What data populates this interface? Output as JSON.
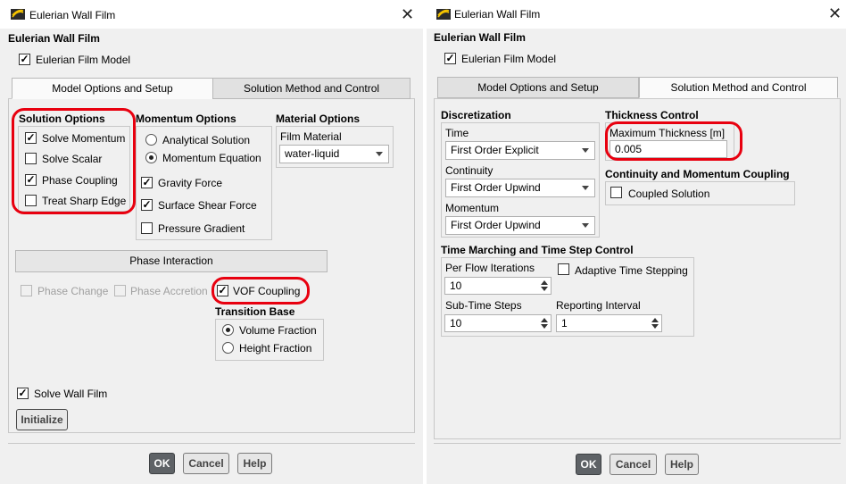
{
  "left": {
    "window_title": "Eulerian Wall Film",
    "header": "Eulerian Wall Film",
    "film_model": {
      "label": "Eulerian Film Model",
      "checked": true
    },
    "tabs": [
      {
        "label": "Model Options and Setup",
        "active": true
      },
      {
        "label": "Solution Method and Control",
        "active": false
      }
    ],
    "solution_options": {
      "title": "Solution Options",
      "items": [
        {
          "label": "Solve Momentum",
          "checked": true
        },
        {
          "label": "Solve Scalar",
          "checked": false
        },
        {
          "label": "Phase Coupling",
          "checked": true
        },
        {
          "label": "Treat Sharp Edge",
          "checked": false
        }
      ]
    },
    "momentum_options": {
      "title": "Momentum Options",
      "radios": [
        {
          "label": "Analytical Solution",
          "selected": false
        },
        {
          "label": "Momentum Equation",
          "selected": true
        }
      ],
      "checks": [
        {
          "label": "Gravity Force",
          "checked": true
        },
        {
          "label": "Surface Shear Force",
          "checked": true
        },
        {
          "label": "Pressure Gradient",
          "checked": false
        }
      ]
    },
    "material_options": {
      "title": "Material Options",
      "field_label": "Film Material",
      "value": "water-liquid"
    },
    "phase_interaction": {
      "label": "Phase Interaction",
      "phase_change": "Phase Change",
      "phase_accretion": "Phase Accretion",
      "vof_coupling": "VOF Coupling",
      "transition_title": "Transition Base",
      "transition_options": [
        {
          "label": "Volume Fraction",
          "selected": true
        },
        {
          "label": "Height Fraction",
          "selected": false
        }
      ]
    },
    "solve_wall_film": {
      "label": "Solve Wall Film",
      "checked": true
    },
    "initialize_label": "Initialize",
    "buttons": {
      "ok": "OK",
      "cancel": "Cancel",
      "help": "Help"
    }
  },
  "right": {
    "window_title": "Eulerian Wall Film",
    "header": "Eulerian Wall Film",
    "film_model": {
      "label": "Eulerian Film Model",
      "checked": true
    },
    "tabs": [
      {
        "label": "Model Options and Setup",
        "active": false
      },
      {
        "label": "Solution Method and Control",
        "active": true
      }
    ],
    "discretization": {
      "title": "Discretization",
      "time_label": "Time",
      "time_value": "First Order Explicit",
      "continuity_label": "Continuity",
      "continuity_value": "First Order Upwind",
      "momentum_label": "Momentum",
      "momentum_value": "First Order Upwind"
    },
    "thickness_control": {
      "title": "Thickness Control",
      "field_label": "Maximum Thickness [m]",
      "value": "0.005"
    },
    "coupling": {
      "title": "Continuity and Momentum Coupling",
      "label": "Coupled Solution",
      "checked": false
    },
    "time_marching": {
      "title": "Time Marching and Time Step Control",
      "per_flow_label": "Per Flow Iterations",
      "per_flow_value": "10",
      "adaptive_label": "Adaptive Time Stepping",
      "adaptive_checked": false,
      "sub_time_label": "Sub-Time Steps",
      "sub_time_value": "10",
      "reporting_label": "Reporting Interval",
      "reporting_value": "1"
    },
    "buttons": {
      "ok": "OK",
      "cancel": "Cancel",
      "help": "Help"
    }
  },
  "checkmark": "✓",
  "close_glyph": "✕",
  "highlight_color": "#e8000f",
  "icons": [
    "app-icon",
    "close-icon",
    "dropdown-arrow-icon",
    "spin-up-icon",
    "spin-down-icon"
  ]
}
